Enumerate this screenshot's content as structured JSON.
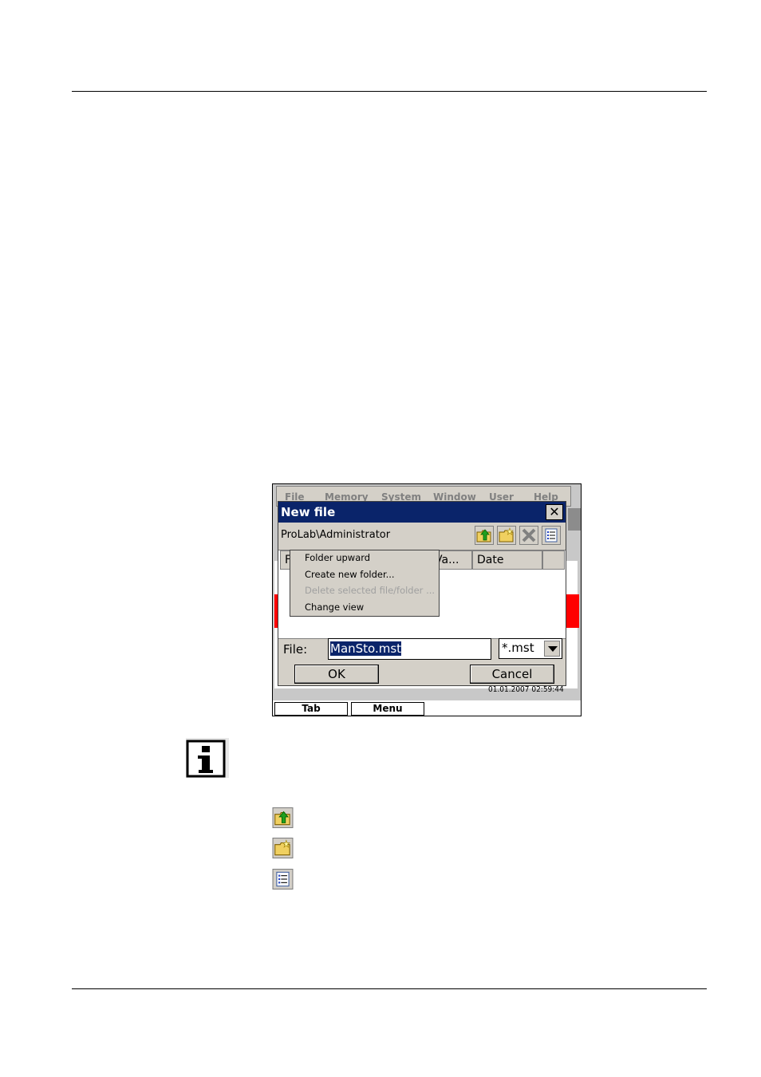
{
  "page": {
    "separator_top": "",
    "separator_bottom": ""
  },
  "device": {
    "background_menubar": {
      "items": [
        "File",
        "Memory",
        "System",
        "Window",
        "User",
        "Help"
      ]
    },
    "dialog": {
      "title": "New file",
      "close_glyph": "✕",
      "path": "ProLab\\Administrator",
      "toolbar_icons": [
        "folder-upward-icon",
        "create-folder-icon",
        "delete-icon",
        "change-view-icon"
      ],
      "columns": [
        "F",
        "Va...",
        "Date"
      ],
      "context_menu": [
        {
          "label": "Folder upward",
          "enabled": true
        },
        {
          "label": "Create new folder...",
          "enabled": true
        },
        {
          "label": "Delete selected file/folder ...",
          "enabled": false
        },
        {
          "label": "Change view",
          "enabled": true
        }
      ],
      "file_label": "File:",
      "file_value": "ManSto.mst",
      "filter_value": "*.mst",
      "ok_label": "OK",
      "cancel_label": "Cancel"
    },
    "status_time": "01.01.2007 02:59:44",
    "softkeys": [
      "Tab",
      "Menu"
    ]
  },
  "colors": {
    "titlebar": "#0a246a",
    "dialog_face": "#d4d0c8",
    "highlight_red": "#ff0000"
  }
}
